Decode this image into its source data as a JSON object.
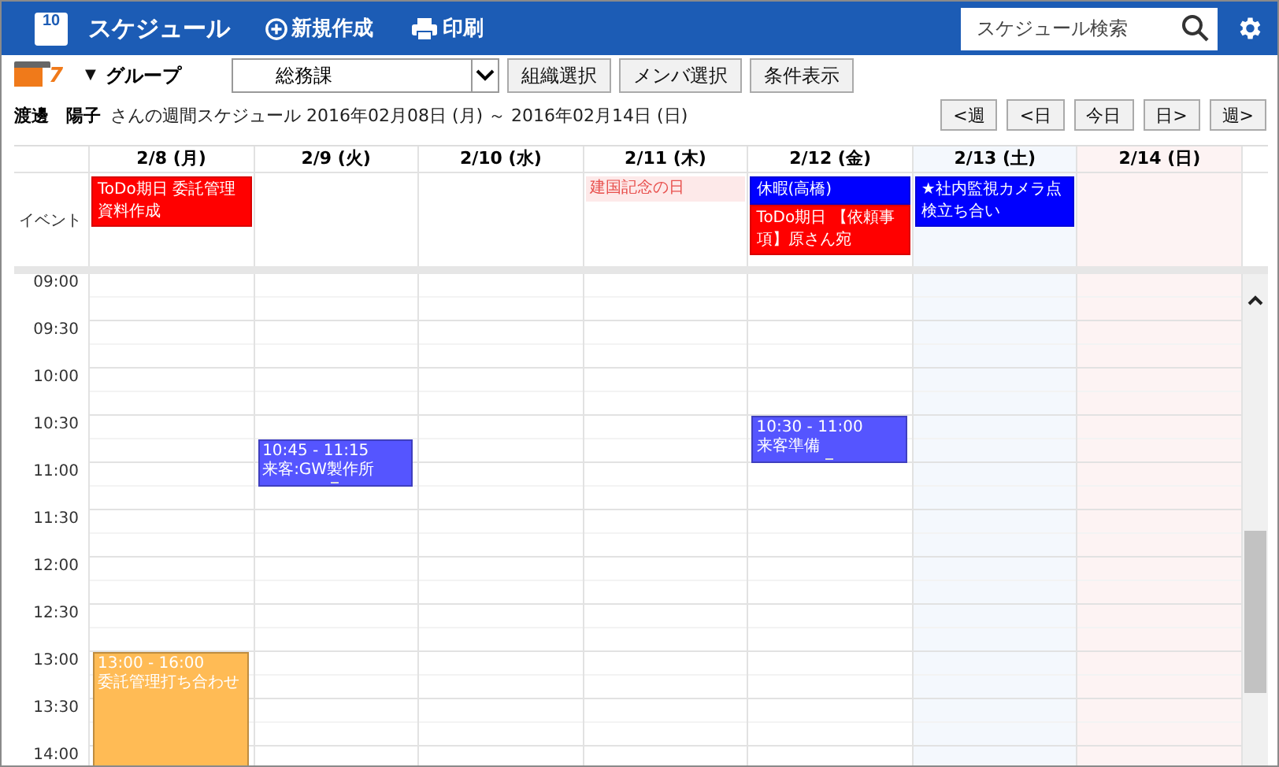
{
  "header": {
    "app_icon_text": "10",
    "title": "スケジュール",
    "new_button": "新規作成",
    "print_button": "印刷",
    "search": {
      "placeholder": "スケジュール検索"
    }
  },
  "toolbar": {
    "view_icon_text": "7",
    "view_menu_caret": "▼",
    "group_label": "グループ",
    "group_select": "総務課",
    "buttons": [
      "組織選択",
      "メンバ選択",
      "条件表示"
    ]
  },
  "info": {
    "user_name": "渡邊　陽子",
    "caption": "さんの週間スケジュール 2016年02月08日 (月) ～ 2016年02月14日 (日)",
    "nav_buttons": [
      "<週",
      "<日",
      "今日",
      "日>",
      "週>"
    ]
  },
  "calendar": {
    "event_row_label": "イベント",
    "time_labels": [
      "09:00",
      "09:30",
      "10:00",
      "10:30",
      "11:00",
      "11:30",
      "12:00",
      "12:30",
      "13:00",
      "13:30",
      "14:00"
    ],
    "days": [
      {
        "label": "2/8 (月)",
        "kind": "weekday",
        "events": [
          {
            "kind": "bar",
            "color": "#ff0000",
            "title": "ToDo期日 委託管理資料作成"
          }
        ],
        "timed_events": [
          {
            "time": "13:00 - 16:00",
            "title": "委託管理打ち合わせ",
            "color": "#ffbb55"
          }
        ]
      },
      {
        "label": "2/9 (火)",
        "kind": "weekday",
        "timed_events": [
          {
            "time": "10:45 - 11:15",
            "title": "来客:GW製作所",
            "color": "#5555ff"
          }
        ]
      },
      {
        "label": "2/10 (水)",
        "kind": "weekday"
      },
      {
        "label": "2/11 (木)",
        "kind": "weekday",
        "events": [
          {
            "kind": "holiday",
            "title": "建国記念の日"
          }
        ]
      },
      {
        "label": "2/12 (金)",
        "kind": "weekday",
        "events": [
          {
            "kind": "bar",
            "color": "#0000ff",
            "title": "休暇(高橋)"
          },
          {
            "kind": "bar",
            "color": "#ff0000",
            "title": "ToDo期日 【依頼事項】原さん宛"
          }
        ],
        "timed_events": [
          {
            "time": "10:30 - 11:00",
            "title": "来客準備",
            "color": "#5555ff"
          }
        ]
      },
      {
        "label": "2/13 (土)",
        "kind": "saturday",
        "events": [
          {
            "kind": "bar",
            "color": "#0000ff",
            "title": "★社内監視カメラ点検立ち合い"
          }
        ]
      },
      {
        "label": "2/14 (日)",
        "kind": "sunday"
      }
    ]
  }
}
